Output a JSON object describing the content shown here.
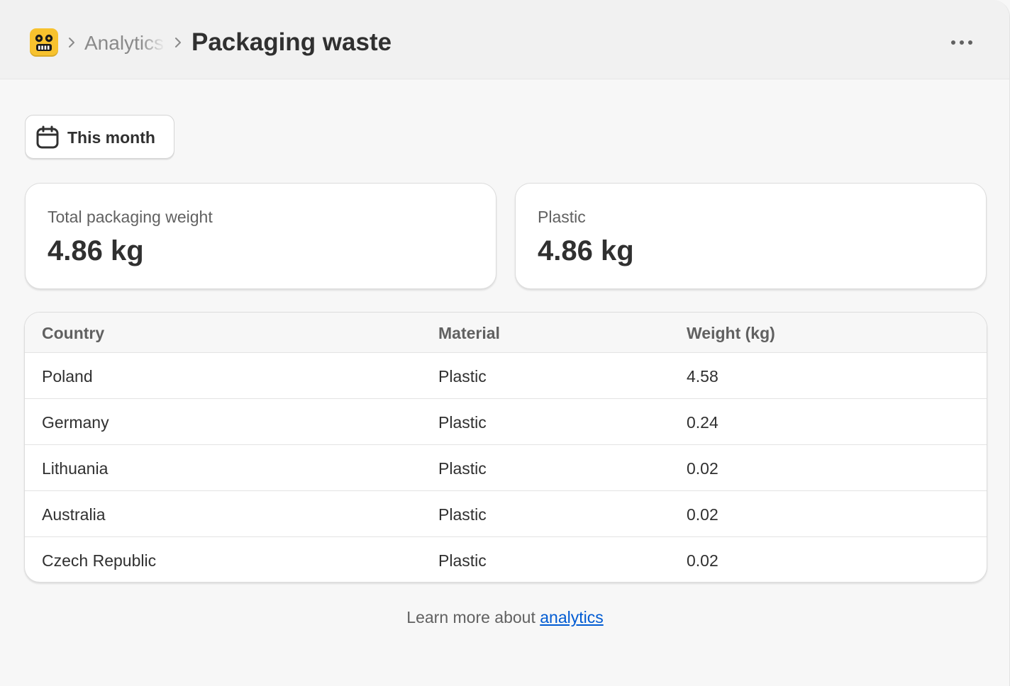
{
  "header": {
    "app_icon": "robot-face-icon",
    "breadcrumb_parent": "Analytics",
    "title": "Packaging waste",
    "more_icon": "more-horizontal-icon"
  },
  "filters": {
    "date_icon": "calendar-icon",
    "date_label": "This month"
  },
  "summary_cards": [
    {
      "label": "Total packaging weight",
      "value": "4.86 kg"
    },
    {
      "label": "Plastic",
      "value": "4.86 kg"
    }
  ],
  "table": {
    "columns": [
      "Country",
      "Material",
      "Weight (kg)"
    ],
    "rows": [
      {
        "country": "Poland",
        "material": "Plastic",
        "weight": "4.58"
      },
      {
        "country": "Germany",
        "material": "Plastic",
        "weight": "0.24"
      },
      {
        "country": "Lithuania",
        "material": "Plastic",
        "weight": "0.02"
      },
      {
        "country": "Australia",
        "material": "Plastic",
        "weight": "0.02"
      },
      {
        "country": "Czech Republic",
        "material": "Plastic",
        "weight": "0.02"
      }
    ]
  },
  "footer": {
    "prefix": "Learn more about ",
    "link_label": "analytics"
  },
  "colors": {
    "brand_yellow": "#f7c22e",
    "link_blue": "#005bd3",
    "text_primary": "#303030",
    "text_secondary": "#616161"
  }
}
